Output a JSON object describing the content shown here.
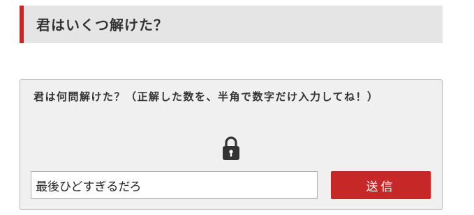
{
  "header": {
    "title": "君はいくつ解けた？"
  },
  "quiz": {
    "question": "君は何問解けた？（正解した数を、半角で数字だけ入力してね！）",
    "lock_icon": "lock-icon",
    "answer_value": "最後ひどすぎるだろ",
    "submit_label": "送信"
  },
  "colors": {
    "accent": "#c62828",
    "header_bg": "#e5e5e5",
    "box_bg": "#f0f0f0"
  }
}
